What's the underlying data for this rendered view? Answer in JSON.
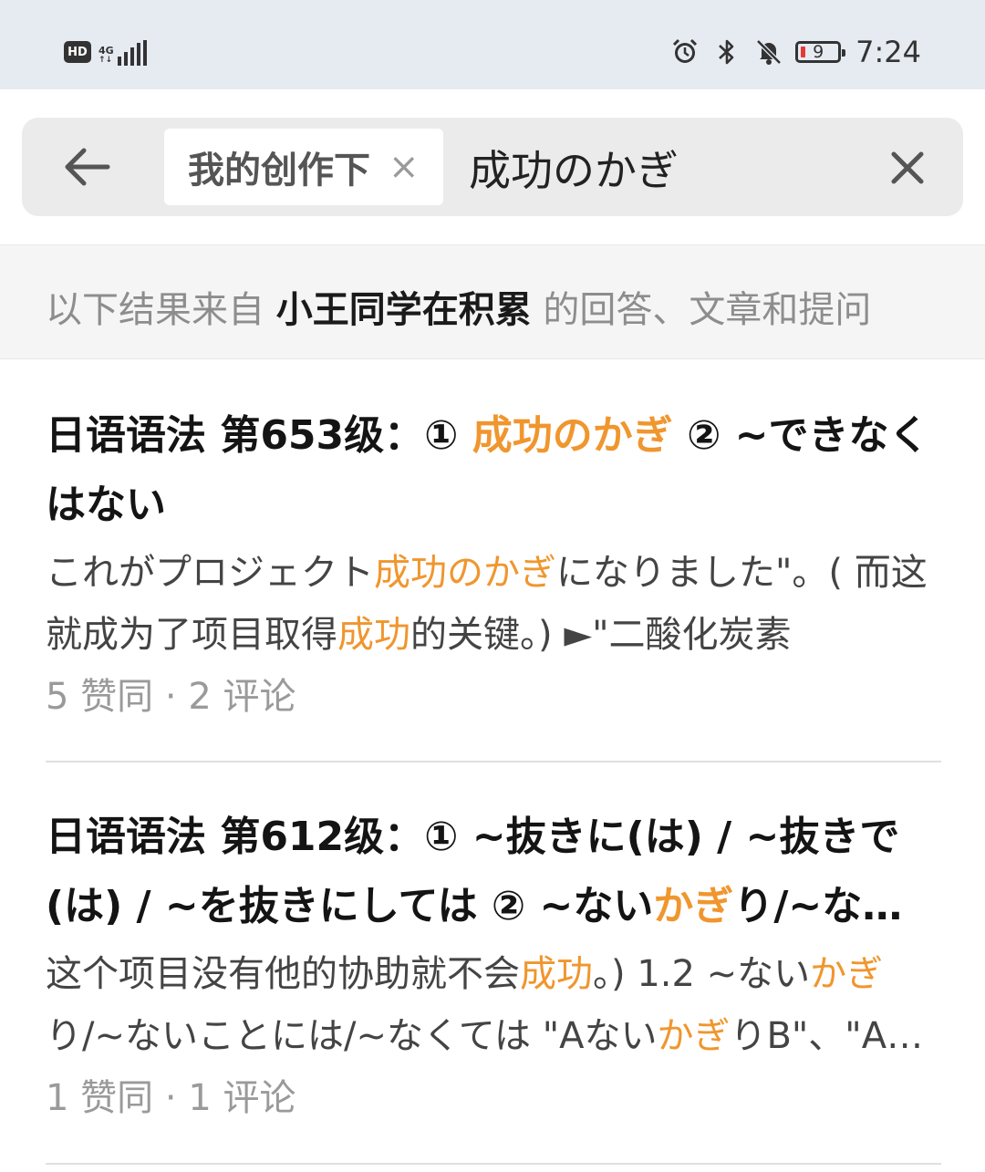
{
  "status_bar": {
    "hd": "HD",
    "network": "4G",
    "battery": "9",
    "time": "7:24"
  },
  "search": {
    "scope_label": "我的创作下",
    "scope_close": "×",
    "query": "成功のかぎ"
  },
  "source": {
    "prefix": "以下结果来自 ",
    "author": "小王同学在积累",
    "suffix": " 的回答、文章和提问"
  },
  "results": [
    {
      "title_parts": [
        "日语语法 第653级：① ",
        "成功のかぎ",
        " ② ~できなくはない"
      ],
      "snippet_parts": [
        "これがプロジェクト",
        "成功のかぎ",
        "になりました\"。( 而这就成为了项目取得",
        "成功",
        "的关键。) ►\"二酸化炭素"
      ],
      "likes": "5 赞同",
      "sep": " · ",
      "comments": "2 评论"
    },
    {
      "title_parts": [
        "日语语法 第612级：① ~抜きに(は) / ~抜きで(は) / ~を抜きにしては ② ~ない",
        "かぎ",
        "り/~ないことには"
      ],
      "snippet_parts": [
        "这个项目没有他的协助就不会",
        "成功",
        "。) 1.2 ~ない",
        "かぎ",
        "り/~ないことには/~なくては \"Aない",
        "かぎ",
        "りB\"、\"Aないことには\""
      ],
      "likes": "1 赞同",
      "sep": " · ",
      "comments": "1 评论"
    }
  ],
  "colors": {
    "highlight": "#f0962e",
    "status_bg": "#e6ebf2",
    "search_bg": "#ebebeb"
  },
  "icons": {
    "back": "back-arrow-icon",
    "clear": "close-icon",
    "alarm": "alarm-icon",
    "bluetooth": "bluetooth-icon",
    "mute": "bell-off-icon"
  }
}
